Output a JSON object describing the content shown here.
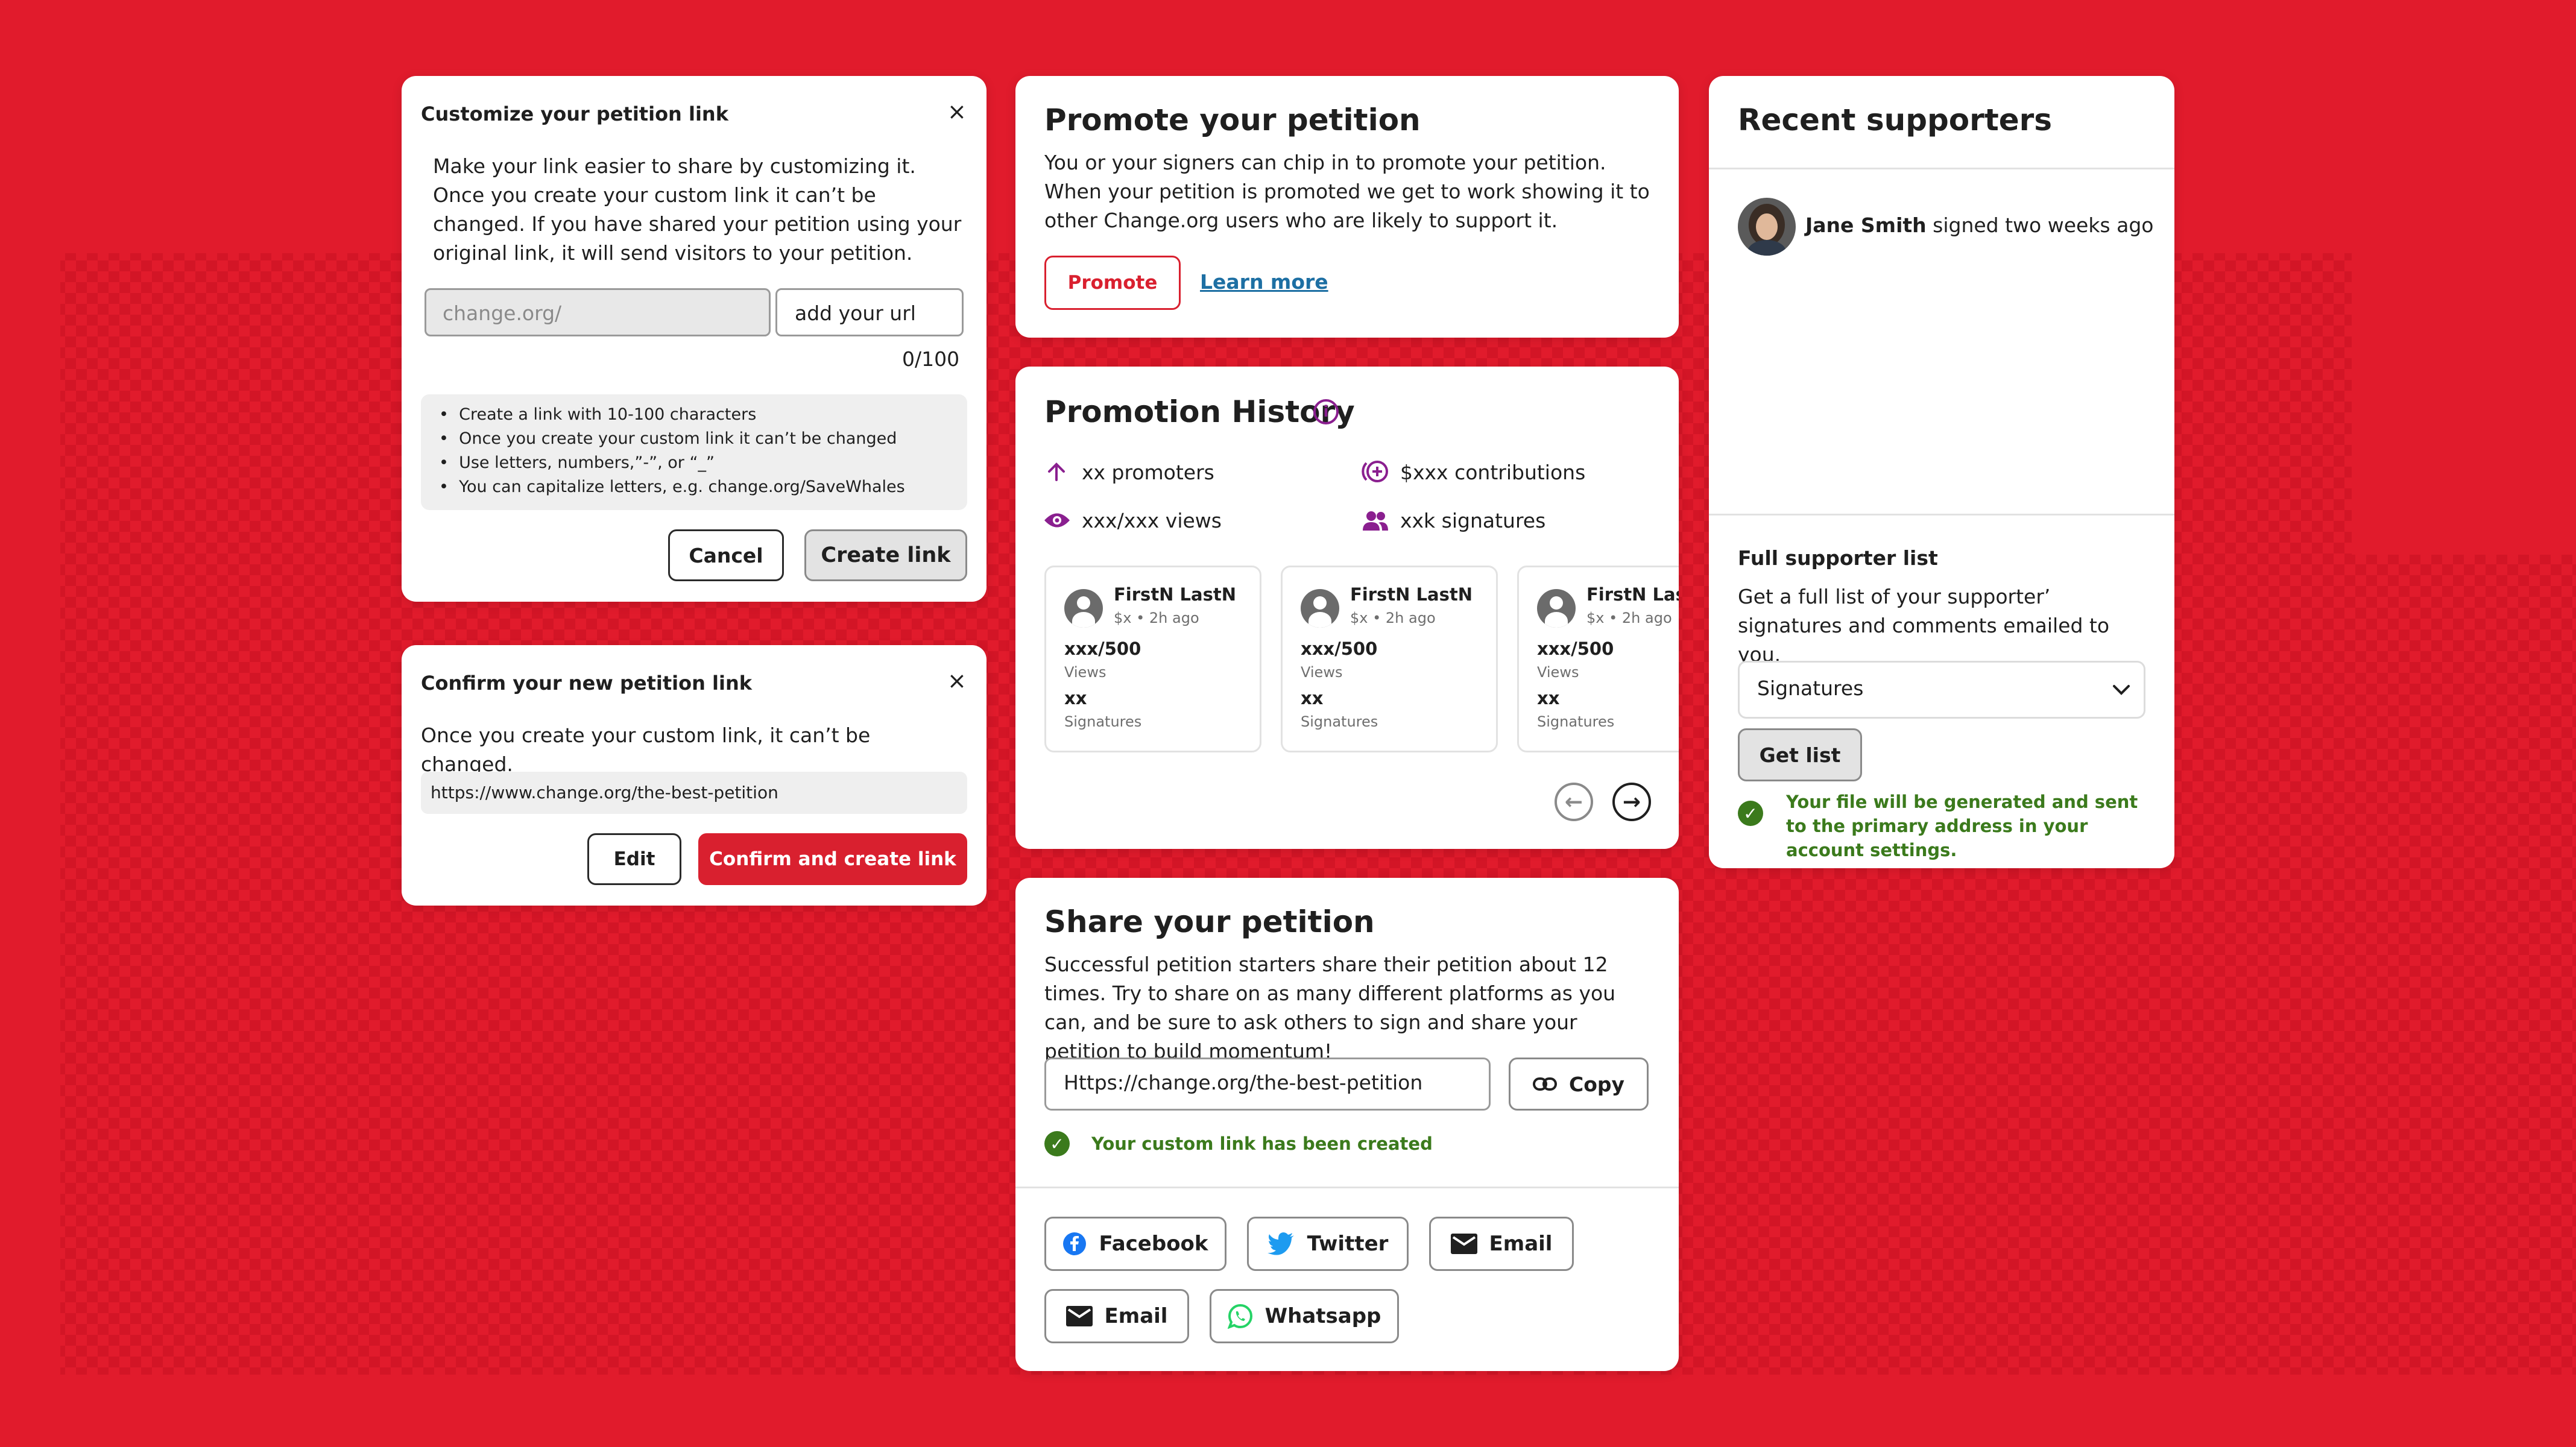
{
  "colors": {
    "brand_red": "#d9202f",
    "success_green": "#3b7a1c",
    "info_purple": "#8a1f8f",
    "link_blue": "#1d6fa3",
    "twitter_blue": "#1d9bf0",
    "whatsapp_green": "#25d366",
    "facebook_blue": "#1877f2"
  },
  "customize": {
    "title": "Customize your petition link",
    "close_icon": "×",
    "description": "Make your link easier to share by customizing it. Once you create your custom link it can’t be changed. If you have shared your petition using your original link, it will send visitors to your petition.",
    "prefix_placeholder": "change.org/",
    "url_placeholder": "add your url",
    "counter": "0/100",
    "rules": [
      "Create a link with 10-100 characters",
      "Once you create your custom link it can’t be changed",
      "Use letters, numbers,”-”, or “_”",
      "You can capitalize letters, e.g. change.org/SaveWhales"
    ],
    "cancel_label": "Cancel",
    "create_label": "Create link"
  },
  "confirm": {
    "title": "Confirm your new petition link",
    "close_icon": "×",
    "description": "Once you create your custom link, it can’t be changed.",
    "url": "https://www.change.org/the-best-petition",
    "edit_label": "Edit",
    "confirm_label": "Confirm and create link"
  },
  "promote": {
    "title": "Promote your petition",
    "description": "You or your signers can chip in to promote your petition. When your petition is promoted we get to work showing it to other Change.org users who are likely to support it.",
    "promote_label": "Promote",
    "learn_more_label": "Learn more"
  },
  "history": {
    "title": "Promotion History",
    "info_icon": "info-icon",
    "stats": {
      "promoters": "xx promoters",
      "contributions": "$xxx contributions",
      "views": "xxx/xxx views",
      "signatures": "xxk signatures"
    },
    "cards": [
      {
        "name": "FirstN LastN",
        "meta": "$x • 2h ago",
        "views_value": "xxx/500",
        "views_label": "Views",
        "signatures_value": "xx",
        "signatures_label": "Signatures"
      },
      {
        "name": "FirstN LastN",
        "meta": "$x • 2h ago",
        "views_value": "xxx/500",
        "views_label": "Views",
        "signatures_value": "xx",
        "signatures_label": "Signatures"
      },
      {
        "name": "FirstN LastN",
        "meta": "$x • 2h ago",
        "views_value": "xxx/500",
        "views_label": "Views",
        "signatures_value": "xx",
        "signatures_label": "Signatures"
      }
    ],
    "prev_icon": "arrow-left-circle-icon",
    "next_icon": "arrow-right-circle-icon"
  },
  "share": {
    "title": "Share your petition",
    "description": "Successful petition starters share their petition about 12 times. Try to share on as many different platforms as you can, and be sure to ask others to sign and share your petition to build momentum!",
    "url_value": "Https://change.org/the-best-petition",
    "copy_label": "Copy",
    "success_message": "Your custom link has been created",
    "buttons": {
      "facebook": "Facebook",
      "twitter": "Twitter",
      "email": "Email",
      "email2": "Email",
      "whatsapp": "Whatsapp"
    }
  },
  "supporters": {
    "title": "Recent supporters",
    "supporter_name": "Jane Smith",
    "supporter_action": "signed two weeks ago",
    "list_title": "Full supporter list",
    "list_description": "Get a full list of your supporter’ signatures and comments emailed to you.",
    "select_value": "Signatures",
    "get_list_label": "Get list",
    "success_message": "Your file will be generated and sent to the primary address in your account settings."
  }
}
